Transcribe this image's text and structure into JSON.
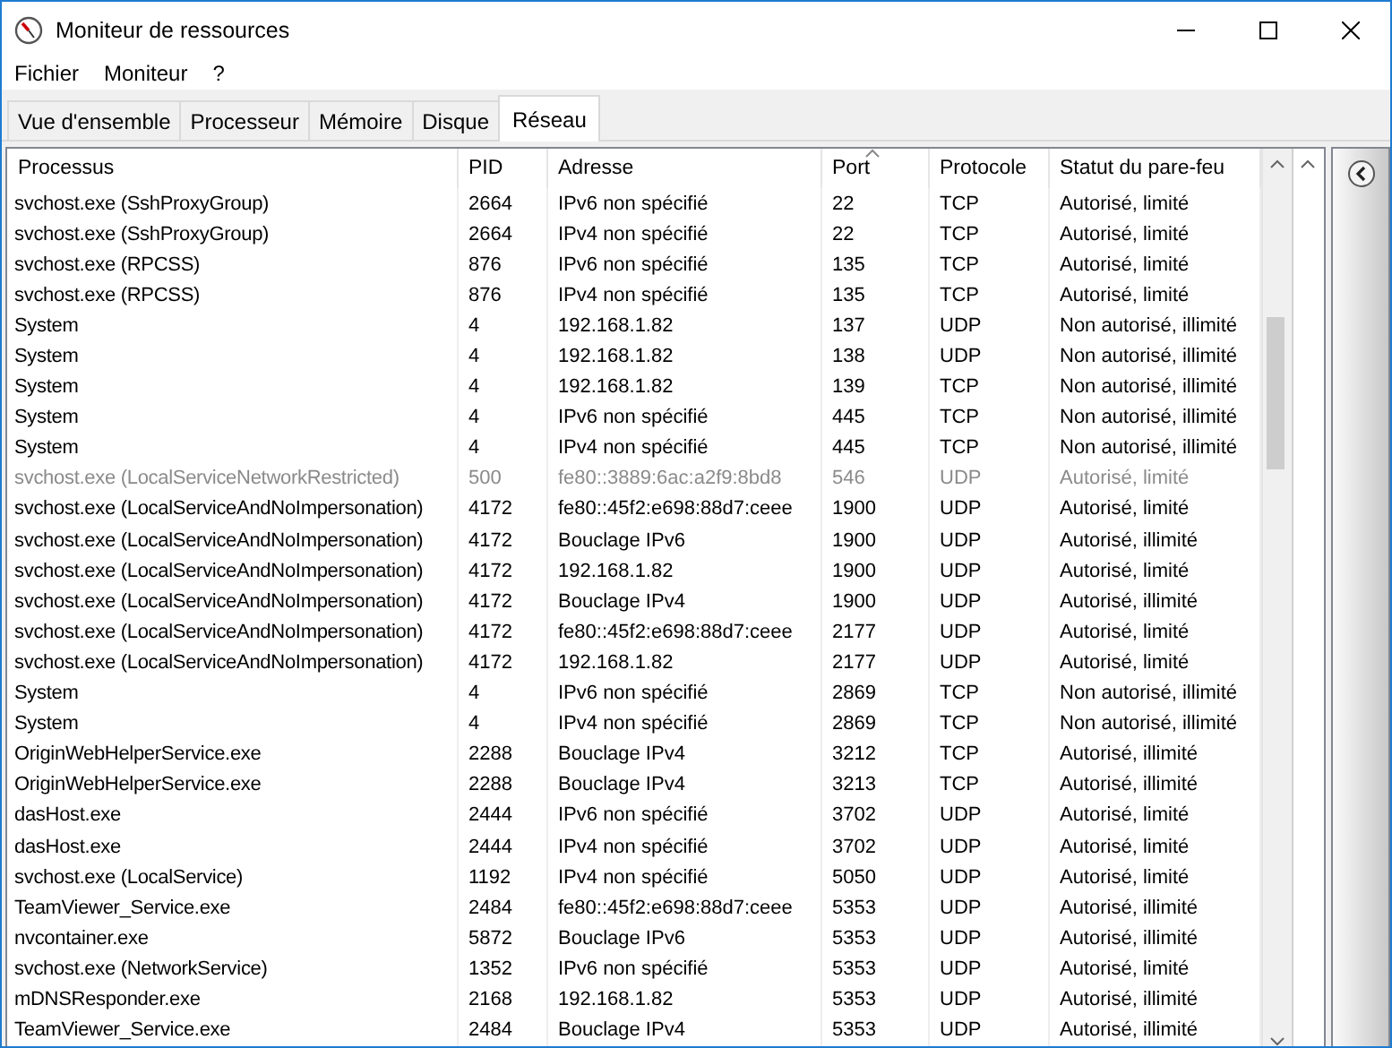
{
  "window": {
    "title": "Moniteur de ressources"
  },
  "menu": [
    "Fichier",
    "Moniteur",
    "?"
  ],
  "tabs": [
    {
      "label": "Vue d'ensemble",
      "selected": false
    },
    {
      "label": "Processeur",
      "selected": false
    },
    {
      "label": "Mémoire",
      "selected": false
    },
    {
      "label": "Disque",
      "selected": false
    },
    {
      "label": "Réseau",
      "selected": true
    }
  ],
  "table": {
    "columns": [
      {
        "label": "Processus",
        "sorted": false
      },
      {
        "label": "PID",
        "sorted": false
      },
      {
        "label": "Adresse",
        "sorted": false
      },
      {
        "label": "Port",
        "sorted": true
      },
      {
        "label": "Protocole",
        "sorted": false
      },
      {
        "label": "Statut du pare-feu",
        "sorted": false
      }
    ],
    "rows": [
      {
        "cells": [
          "svchost.exe (SshProxyGroup)",
          "2664",
          "IPv6 non spécifié",
          "22",
          "TCP",
          "Autorisé, limité"
        ],
        "disabled": false
      },
      {
        "cells": [
          "svchost.exe (SshProxyGroup)",
          "2664",
          "IPv4 non spécifié",
          "22",
          "TCP",
          "Autorisé, limité"
        ],
        "disabled": false
      },
      {
        "cells": [
          "svchost.exe (RPCSS)",
          "876",
          "IPv6 non spécifié",
          "135",
          "TCP",
          "Autorisé, limité"
        ],
        "disabled": false
      },
      {
        "cells": [
          "svchost.exe (RPCSS)",
          "876",
          "IPv4 non spécifié",
          "135",
          "TCP",
          "Autorisé, limité"
        ],
        "disabled": false
      },
      {
        "cells": [
          "System",
          "4",
          "192.168.1.82",
          "137",
          "UDP",
          "Non autorisé, illimité"
        ],
        "disabled": false
      },
      {
        "cells": [
          "System",
          "4",
          "192.168.1.82",
          "138",
          "UDP",
          "Non autorisé, illimité"
        ],
        "disabled": false
      },
      {
        "cells": [
          "System",
          "4",
          "192.168.1.82",
          "139",
          "TCP",
          "Non autorisé, illimité"
        ],
        "disabled": false
      },
      {
        "cells": [
          "System",
          "4",
          "IPv6 non spécifié",
          "445",
          "TCP",
          "Non autorisé, illimité"
        ],
        "disabled": false
      },
      {
        "cells": [
          "System",
          "4",
          "IPv4 non spécifié",
          "445",
          "TCP",
          "Non autorisé, illimité"
        ],
        "disabled": false
      },
      {
        "cells": [
          "svchost.exe (LocalServiceNetworkRestricted)",
          "500",
          "fe80::3889:6ac:a2f9:8bd8",
          "546",
          "UDP",
          "Autorisé, limité"
        ],
        "disabled": true
      },
      {
        "cells": [
          "svchost.exe (LocalServiceAndNoImpersonation)",
          "4172",
          "fe80::45f2:e698:88d7:ceee",
          "1900",
          "UDP",
          "Autorisé, limité"
        ],
        "disabled": false
      },
      {
        "cells": [
          "svchost.exe (LocalServiceAndNoImpersonation)",
          "4172",
          "Bouclage IPv6",
          "1900",
          "UDP",
          "Autorisé, illimité"
        ],
        "disabled": false
      },
      {
        "cells": [
          "svchost.exe (LocalServiceAndNoImpersonation)",
          "4172",
          "192.168.1.82",
          "1900",
          "UDP",
          "Autorisé, limité"
        ],
        "disabled": false
      },
      {
        "cells": [
          "svchost.exe (LocalServiceAndNoImpersonation)",
          "4172",
          "Bouclage IPv4",
          "1900",
          "UDP",
          "Autorisé, illimité"
        ],
        "disabled": false
      },
      {
        "cells": [
          "svchost.exe (LocalServiceAndNoImpersonation)",
          "4172",
          "fe80::45f2:e698:88d7:ceee",
          "2177",
          "UDP",
          "Autorisé, limité"
        ],
        "disabled": false
      },
      {
        "cells": [
          "svchost.exe (LocalServiceAndNoImpersonation)",
          "4172",
          "192.168.1.82",
          "2177",
          "UDP",
          "Autorisé, limité"
        ],
        "disabled": false
      },
      {
        "cells": [
          "System",
          "4",
          "IPv6 non spécifié",
          "2869",
          "TCP",
          "Non autorisé, illimité"
        ],
        "disabled": false
      },
      {
        "cells": [
          "System",
          "4",
          "IPv4 non spécifié",
          "2869",
          "TCP",
          "Non autorisé, illimité"
        ],
        "disabled": false
      },
      {
        "cells": [
          "OriginWebHelperService.exe",
          "2288",
          "Bouclage IPv4",
          "3212",
          "TCP",
          "Autorisé, illimité"
        ],
        "disabled": false
      },
      {
        "cells": [
          "OriginWebHelperService.exe",
          "2288",
          "Bouclage IPv4",
          "3213",
          "TCP",
          "Autorisé, illimité"
        ],
        "disabled": false
      },
      {
        "cells": [
          "dasHost.exe",
          "2444",
          "IPv6 non spécifié",
          "3702",
          "UDP",
          "Autorisé, limité"
        ],
        "disabled": false
      },
      {
        "cells": [
          "dasHost.exe",
          "2444",
          "IPv4 non spécifié",
          "3702",
          "UDP",
          "Autorisé, limité"
        ],
        "disabled": false
      },
      {
        "cells": [
          "svchost.exe (LocalService)",
          "1192",
          "IPv4 non spécifié",
          "5050",
          "UDP",
          "Autorisé, limité"
        ],
        "disabled": false
      },
      {
        "cells": [
          "TeamViewer_Service.exe",
          "2484",
          "fe80::45f2:e698:88d7:ceee",
          "5353",
          "UDP",
          "Autorisé, illimité"
        ],
        "disabled": false
      },
      {
        "cells": [
          "nvcontainer.exe",
          "5872",
          "Bouclage IPv6",
          "5353",
          "UDP",
          "Autorisé, illimité"
        ],
        "disabled": false
      },
      {
        "cells": [
          "svchost.exe (NetworkService)",
          "1352",
          "IPv6 non spécifié",
          "5353",
          "UDP",
          "Autorisé, limité"
        ],
        "disabled": false
      },
      {
        "cells": [
          "mDNSResponder.exe",
          "2168",
          "192.168.1.82",
          "5353",
          "UDP",
          "Autorisé, illimité"
        ],
        "disabled": false
      },
      {
        "cells": [
          "TeamViewer_Service.exe",
          "2484",
          "Bouclage IPv4",
          "5353",
          "UDP",
          "Autorisé, illimité"
        ],
        "disabled": false
      }
    ]
  }
}
